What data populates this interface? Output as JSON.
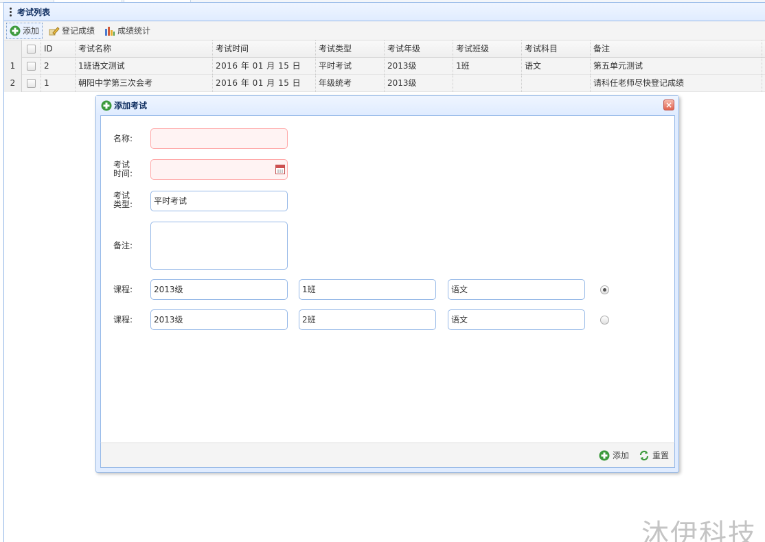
{
  "panel": {
    "title": "考试列表"
  },
  "toolbar": {
    "add_label": "添加",
    "register_label": "登记成绩",
    "stats_label": "成绩统计"
  },
  "grid": {
    "columns": [
      "",
      "ID",
      "考试名称",
      "考试时间",
      "考试类型",
      "考试年级",
      "考试班级",
      "考试科目",
      "备注"
    ],
    "rows": [
      {
        "rownum": "1",
        "id": "2",
        "name": "1班语文测试",
        "time": "2016 年 01 月 15 日",
        "type": "平时考试",
        "grade": "2013级",
        "clazz": "1班",
        "subject": "语文",
        "note": "第五单元测试"
      },
      {
        "rownum": "2",
        "id": "1",
        "name": "朝阳中学第三次会考",
        "time": "2016 年 01 月 15 日",
        "type": "年级统考",
        "grade": "2013级",
        "clazz": "",
        "subject": "",
        "note": "请科任老师尽快登记成绩"
      }
    ]
  },
  "dialog": {
    "title": "添加考试",
    "labels": {
      "name": "名称:",
      "time_1": "考试",
      "time_2": "时间:",
      "type_1": "考试",
      "type_2": "类型:",
      "note": "备注:",
      "course": "课程:"
    },
    "values": {
      "name": "",
      "time": "",
      "type": "平时考试",
      "note": ""
    },
    "courses": [
      {
        "grade": "2013级",
        "clazz": "1班",
        "subject": "语文",
        "selected": true
      },
      {
        "grade": "2013级",
        "clazz": "2班",
        "subject": "语文",
        "selected": false
      }
    ],
    "footer": {
      "add_label": "添加",
      "reset_label": "重置"
    }
  },
  "watermark": "沐伊科技",
  "colors": {
    "border": "#95b8e7",
    "header": "#e0ecff",
    "invalid": "#ffa8a8"
  },
  "icons": [
    "menu-dots-icon",
    "add-icon",
    "edit-icon",
    "chart-icon",
    "close-icon",
    "calendar-icon",
    "reload-icon"
  ]
}
